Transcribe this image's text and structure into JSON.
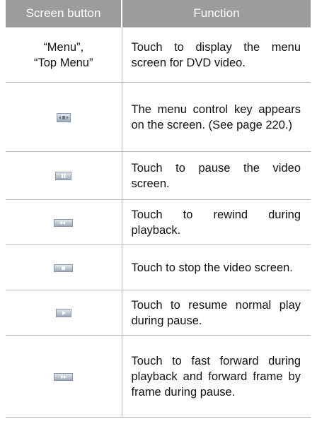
{
  "header": {
    "col1": "Screen button",
    "col2": "Function"
  },
  "rows": [
    {
      "button_text_1": "“Menu”,",
      "button_text_2": "“Top Menu”",
      "function": "Touch to display the menu screen for DVD video."
    },
    {
      "icon": "menu-control-key-icon",
      "function": "The menu control key appears on the screen. (See page 220.)"
    },
    {
      "icon": "pause-icon",
      "function": "Touch to pause the video screen."
    },
    {
      "icon": "rewind-icon",
      "function": "Touch to rewind during playback."
    },
    {
      "icon": "stop-icon",
      "function": "Touch to stop the video screen."
    },
    {
      "icon": "play-icon",
      "function": "Touch to resume normal play during pause."
    },
    {
      "icon": "fast-forward-icon",
      "function": "Touch to fast forward during playback and forward frame by frame during pause."
    }
  ]
}
